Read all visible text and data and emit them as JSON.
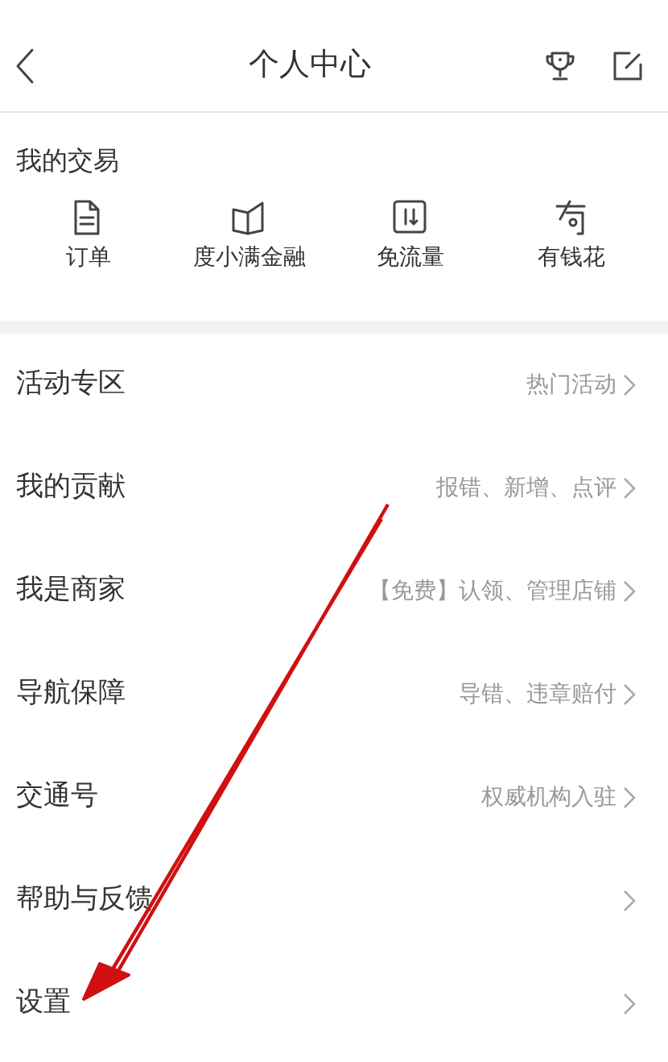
{
  "header": {
    "title": "个人中心"
  },
  "trade": {
    "title": "我的交易",
    "items": [
      {
        "kind": "order",
        "label": "订单"
      },
      {
        "kind": "book",
        "label": "度小满金融"
      },
      {
        "kind": "data",
        "label": "免流量"
      },
      {
        "kind": "money",
        "label": "有钱花"
      }
    ]
  },
  "menu": [
    {
      "label": "活动专区",
      "hint": "热门活动"
    },
    {
      "label": "我的贡献",
      "hint": "报错、新增、点评"
    },
    {
      "label": "我是商家",
      "hint": "【免费】认领、管理店铺"
    },
    {
      "label": "导航保障",
      "hint": "导错、违章赔付"
    },
    {
      "label": "交通号",
      "hint": "权威机构入驻"
    },
    {
      "label": "帮助与反馈"
    },
    {
      "label": "设置"
    }
  ]
}
